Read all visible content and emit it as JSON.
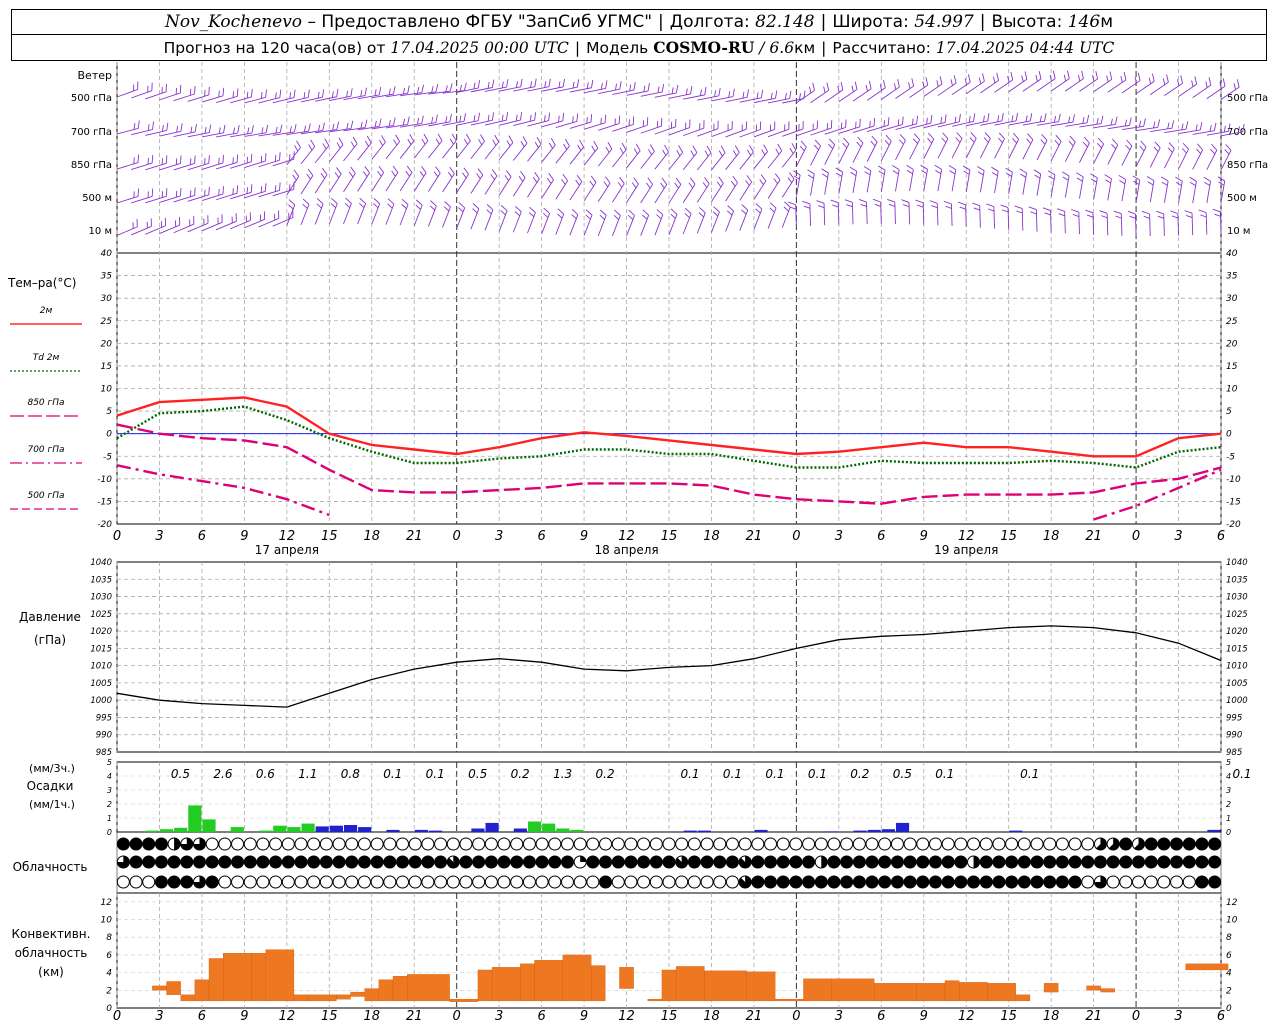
{
  "header": {
    "station": "Nov_Kochenevo",
    "provider": "– Предоставлено ФГБУ \"ЗапСиб УГМС\"",
    "lon_label": "Долгота:",
    "lon_value": "82.148",
    "lat_label": "Широта:",
    "lat_value": "54.997",
    "alt_label": "Высота:",
    "alt_value": "146",
    "alt_unit": "м",
    "forecast_prefix": "Прогноз на 120 часа(ов) от",
    "forecast_start": "17.04.2025 00:00 UTC",
    "model_label": "Модель",
    "model_name": "COSMO-RU",
    "model_res": "/ 6.6",
    "model_res_unit": "км",
    "calc_label": "Рассчитано:",
    "calc_time": "17.04.2025 04:44 UTC"
  },
  "chart_data": {
    "type": "meteogram",
    "x_hour_ticks": [
      "0",
      "3",
      "6",
      "9",
      "12",
      "15",
      "18",
      "21",
      "0",
      "3",
      "6",
      "9",
      "12",
      "15",
      "18",
      "21",
      "0",
      "3",
      "6",
      "9",
      "12",
      "15",
      "18",
      "21",
      "0",
      "3",
      "6"
    ],
    "day_labels": [
      "17 апреля",
      "18 апреля",
      "19 апреля"
    ],
    "wind": {
      "title": "Ветер",
      "levels": [
        "500 гПа",
        "700 гПа",
        "850 гПа",
        "500 м",
        "10 м"
      ]
    },
    "temperature": {
      "title": "Тем–ра(°C)",
      "ylim": [
        -20,
        40
      ],
      "ticks": [
        40,
        35,
        30,
        25,
        20,
        15,
        10,
        5,
        0,
        -5,
        -10,
        -15,
        -20
      ],
      "legend": [
        {
          "label": "2м",
          "color": "#ff0000",
          "style": "solid"
        },
        {
          "label": "Td  2м",
          "color": "#006600",
          "style": "dotted"
        },
        {
          "label": "850 гПа",
          "color": "#dd0077",
          "style": "longdash"
        },
        {
          "label": "700 гПа",
          "color": "#dd0077",
          "style": "dashdot"
        },
        {
          "label": "500 гПа",
          "color": "#dd0077",
          "style": "dashed"
        }
      ],
      "x_hours": [
        0,
        3,
        6,
        9,
        12,
        15,
        18,
        21,
        24,
        27,
        30,
        33,
        36,
        39,
        42,
        45,
        48,
        51,
        54,
        57,
        60,
        63,
        66,
        69,
        72,
        75,
        78
      ],
      "series": [
        {
          "name": "2м",
          "values": [
            4,
            7,
            7.5,
            8,
            6,
            0,
            -2.5,
            -3.5,
            -4.5,
            -3,
            -1,
            0.3,
            -0.5,
            -1.5,
            -2.5,
            -3.5,
            -4.5,
            -4,
            -3,
            -2,
            -3,
            -3,
            -4,
            -5,
            -5,
            -1,
            0
          ]
        },
        {
          "name": "Td  2м",
          "values": [
            -1,
            4.5,
            5,
            6,
            3,
            -1,
            -4,
            -6.5,
            -6.5,
            -5.5,
            -5,
            -3.5,
            -3.5,
            -4.5,
            -4.5,
            -6,
            -7.5,
            -7.5,
            -6,
            -6.5,
            -6.5,
            -6.5,
            -6,
            -6.5,
            -7.5,
            -4,
            -3
          ]
        },
        {
          "name": "850 гПа",
          "values": [
            2,
            0,
            -1,
            -1.5,
            -3,
            -8,
            -12.5,
            -13,
            -13,
            -12.5,
            -12,
            -11,
            -11,
            -11,
            -11.5,
            -13.5,
            -14.5,
            -15,
            -15.5,
            -14,
            -13.5,
            -13.5,
            -13.5,
            -13,
            -11,
            -10,
            -7.5
          ]
        },
        {
          "name": "700 гПа",
          "values": [
            -7,
            -9,
            -10.5,
            -12,
            -14.5,
            -18,
            -21,
            null,
            null,
            null,
            null,
            null,
            null,
            null,
            null,
            null,
            null,
            null,
            null,
            null,
            null,
            null,
            null,
            -19,
            -16,
            -12,
            -8
          ]
        }
      ]
    },
    "pressure": {
      "title": "Давление",
      "unit": "(гПа)",
      "ylim": [
        985,
        1040
      ],
      "ticks": [
        1040,
        1035,
        1030,
        1025,
        1020,
        1015,
        1010,
        1005,
        1000,
        995,
        990,
        985
      ],
      "x_hours": [
        0,
        3,
        6,
        9,
        12,
        15,
        18,
        21,
        24,
        27,
        30,
        33,
        36,
        39,
        42,
        45,
        48,
        51,
        54,
        57,
        60,
        63,
        66,
        69,
        72,
        75,
        78
      ],
      "values": [
        1002,
        1000,
        999,
        998.5,
        998,
        1002,
        1006,
        1009,
        1011,
        1012,
        1011,
        1009,
        1008.5,
        1009.5,
        1010,
        1012,
        1015,
        1017.5,
        1018.5,
        1019,
        1020,
        1021,
        1021.5,
        1021,
        1019.5,
        1016.5,
        1011.5
      ]
    },
    "precipitation": {
      "title": "Осадки",
      "unit_3h": "(мм/3ч.)",
      "unit_1h": "(мм/1ч.)",
      "ylim": [
        0,
        5
      ],
      "ticks": [
        5,
        4,
        3,
        2,
        1,
        0
      ],
      "totals_3h": [
        {
          "h": 3,
          "v": "0.5"
        },
        {
          "h": 6,
          "v": "2.6"
        },
        {
          "h": 9,
          "v": "0.6"
        },
        {
          "h": 12,
          "v": "1.1"
        },
        {
          "h": 15,
          "v": "0.8"
        },
        {
          "h": 18,
          "v": "0.1"
        },
        {
          "h": 21,
          "v": "0.1"
        },
        {
          "h": 24,
          "v": "0.5"
        },
        {
          "h": 27,
          "v": "0.2"
        },
        {
          "h": 30,
          "v": "1.3"
        },
        {
          "h": 33,
          "v": "0.2"
        },
        {
          "h": 39,
          "v": "0.1"
        },
        {
          "h": 42,
          "v": "0.1"
        },
        {
          "h": 45,
          "v": "0.1"
        },
        {
          "h": 48,
          "v": "0.1"
        },
        {
          "h": 51,
          "v": "0.2"
        },
        {
          "h": 54,
          "v": "0.5"
        },
        {
          "h": 57,
          "v": "0.1"
        },
        {
          "h": 63,
          "v": "0.1"
        },
        {
          "h": 78,
          "v": "0.1"
        }
      ],
      "hourly_green": [
        {
          "h": 2.5,
          "v": 0.1
        },
        {
          "h": 3.5,
          "v": 0.2
        },
        {
          "h": 4.5,
          "v": 0.3
        },
        {
          "h": 5.5,
          "v": 1.9
        },
        {
          "h": 6.5,
          "v": 0.9
        },
        {
          "h": 8.5,
          "v": 0.35
        },
        {
          "h": 10.5,
          "v": 0.1
        },
        {
          "h": 11.5,
          "v": 0.45
        },
        {
          "h": 12.5,
          "v": 0.35
        },
        {
          "h": 13.5,
          "v": 0.6
        },
        {
          "h": 15.5,
          "v": 0.1
        },
        {
          "h": 26.5,
          "v": 0.2
        },
        {
          "h": 29.5,
          "v": 0.75
        },
        {
          "h": 30.5,
          "v": 0.6
        },
        {
          "h": 31.5,
          "v": 0.25
        },
        {
          "h": 32.5,
          "v": 0.15
        }
      ],
      "hourly_blue": [
        {
          "h": 14.5,
          "v": 0.4
        },
        {
          "h": 15.5,
          "v": 0.45
        },
        {
          "h": 16.5,
          "v": 0.5
        },
        {
          "h": 17.5,
          "v": 0.35
        },
        {
          "h": 19.5,
          "v": 0.15
        },
        {
          "h": 21.5,
          "v": 0.15
        },
        {
          "h": 22.5,
          "v": 0.1
        },
        {
          "h": 25.5,
          "v": 0.25
        },
        {
          "h": 26.5,
          "v": 0.65
        },
        {
          "h": 28.5,
          "v": 0.25
        },
        {
          "h": 40.5,
          "v": 0.1
        },
        {
          "h": 41.5,
          "v": 0.1
        },
        {
          "h": 45.5,
          "v": 0.15
        },
        {
          "h": 50.5,
          "v": 0.05
        },
        {
          "h": 52.5,
          "v": 0.1
        },
        {
          "h": 53.5,
          "v": 0.15
        },
        {
          "h": 54.5,
          "v": 0.2
        },
        {
          "h": 55.5,
          "v": 0.65
        },
        {
          "h": 63.5,
          "v": 0.1
        },
        {
          "h": 77.5,
          "v": 0.15
        }
      ],
      "colors": {
        "hourly_green": "#22cc22",
        "hourly_blue": "#2222cc"
      }
    },
    "cloudiness": {
      "title": "Облачность",
      "rows": [
        "8,8,8,8,4,6,6,0,0,0,0,0,0,0,0,0,0,0,0,0,0,0,0,0,0,0,0,0,0,0,0,0,0,0,0,0,0,0,0,0,0,0,0,0,0,0,0,0,0,0,0,0,0,0,0,0,0,0,0,0,0,0,0,0,0,0,0,0,0,0,0,0,0,0,0,0,0,5,5,8,5,8,8,8,8,8,8",
        "6,8,8,8,8,8,8,8,8,8,8,8,8,8,8,8,8,8,8,8,8,8,8,8,8,8,7,8,8,8,8,8,8,8,8,8,2,8,8,8,8,8,8,8,7,8,8,8,8,7,8,8,8,8,8,4,8,8,8,8,8,8,8,8,8,8,8,4,8,8,8,8,8,8,8,8,8,8,8,8,8,8,8,8,8,8,8",
        "0,0,0,8,8,8,6,8,0,0,0,0,0,0,0,0,0,0,0,0,0,0,0,0,0,0,0,0,0,0,0,0,0,0,0,0,0,0,8,0,0,0,0,0,0,0,0,0,0,7,8,8,8,8,8,8,8,8,8,8,8,8,8,8,8,8,8,8,8,8,8,8,8,8,8,8,0,6,0,0,0,0,0,0,0,8,8"
      ]
    },
    "convective": {
      "title_lines": [
        "Конвективн.",
        "облачность",
        "(км)"
      ],
      "ylim": [
        0,
        13
      ],
      "ticks": [
        12,
        10,
        8,
        6,
        4,
        2,
        0
      ],
      "color": "#ee7722",
      "bars": [
        {
          "h0": 2.5,
          "h1": 3.5,
          "top": 2.5,
          "base": 2
        },
        {
          "h0": 3.5,
          "h1": 4.5,
          "top": 3,
          "base": 1.5
        },
        {
          "h0": 4.5,
          "h1": 5.5,
          "top": 1.5,
          "base": 0.8
        },
        {
          "h0": 5.5,
          "h1": 6.5,
          "top": 3.2,
          "base": 0.8
        },
        {
          "h0": 6.5,
          "h1": 7.5,
          "top": 5.6,
          "base": 0.8
        },
        {
          "h0": 7.5,
          "h1": 9.5,
          "top": 6.2,
          "base": 0.8
        },
        {
          "h0": 9.5,
          "h1": 10.5,
          "top": 6.2,
          "base": 0.8
        },
        {
          "h0": 10.5,
          "h1": 12.5,
          "top": 6.6,
          "base": 0.8
        },
        {
          "h0": 12.5,
          "h1": 13.5,
          "top": 1.5,
          "base": 0.8
        },
        {
          "h0": 13.5,
          "h1": 15.5,
          "top": 1.5,
          "base": 0.8
        },
        {
          "h0": 15.5,
          "h1": 16.5,
          "top": 1.5,
          "base": 1
        },
        {
          "h0": 16.5,
          "h1": 17.5,
          "top": 1.8,
          "base": 1.3
        },
        {
          "h0": 17.5,
          "h1": 18.5,
          "top": 2.2,
          "base": 0.8
        },
        {
          "h0": 18.5,
          "h1": 19.5,
          "top": 3.2,
          "base": 0.8
        },
        {
          "h0": 19.5,
          "h1": 20.5,
          "top": 3.6,
          "base": 0.8
        },
        {
          "h0": 20.5,
          "h1": 23.5,
          "top": 3.8,
          "base": 0.8
        },
        {
          "h0": 23.5,
          "h1": 25.5,
          "top": 1,
          "base": 0.7
        },
        {
          "h0": 25.5,
          "h1": 26.5,
          "top": 4.3,
          "base": 0.8
        },
        {
          "h0": 26.5,
          "h1": 28.5,
          "top": 4.6,
          "base": 0.8
        },
        {
          "h0": 28.5,
          "h1": 29.5,
          "top": 5,
          "base": 0.8
        },
        {
          "h0": 29.5,
          "h1": 31.5,
          "top": 5.4,
          "base": 0.8
        },
        {
          "h0": 31.5,
          "h1": 33.5,
          "top": 6,
          "base": 0.8
        },
        {
          "h0": 33.5,
          "h1": 34.5,
          "top": 4.8,
          "base": 0.8
        },
        {
          "h0": 35.5,
          "h1": 36.5,
          "top": 4.6,
          "base": 2.2
        },
        {
          "h0": 37.5,
          "h1": 38.5,
          "top": 1,
          "base": 0.8
        },
        {
          "h0": 38.5,
          "h1": 39.5,
          "top": 4.3,
          "base": 0.8
        },
        {
          "h0": 39.5,
          "h1": 41.5,
          "top": 4.7,
          "base": 0.8
        },
        {
          "h0": 41.5,
          "h1": 44.5,
          "top": 4.2,
          "base": 0.8
        },
        {
          "h0": 44.5,
          "h1": 46.5,
          "top": 4.1,
          "base": 0.8
        },
        {
          "h0": 46.5,
          "h1": 48.5,
          "top": 1,
          "base": 0.8
        },
        {
          "h0": 48.5,
          "h1": 50.5,
          "top": 3.3,
          "base": 0.8
        },
        {
          "h0": 50.5,
          "h1": 53.5,
          "top": 3.3,
          "base": 0.8
        },
        {
          "h0": 53.5,
          "h1": 56.5,
          "top": 2.8,
          "base": 0.8
        },
        {
          "h0": 56.5,
          "h1": 58.5,
          "top": 2.8,
          "base": 0.8
        },
        {
          "h0": 58.5,
          "h1": 59.5,
          "top": 3.1,
          "base": 0.8
        },
        {
          "h0": 59.5,
          "h1": 61.5,
          "top": 2.9,
          "base": 0.8
        },
        {
          "h0": 61.5,
          "h1": 63.5,
          "top": 2.8,
          "base": 0.8
        },
        {
          "h0": 63.5,
          "h1": 64.5,
          "top": 1.5,
          "base": 0.8
        },
        {
          "h0": 65.5,
          "h1": 66.5,
          "top": 2.8,
          "base": 1.8
        },
        {
          "h0": 68.5,
          "h1": 69.5,
          "top": 2.5,
          "base": 2
        },
        {
          "h0": 69.5,
          "h1": 70.5,
          "top": 2.2,
          "base": 1.8
        },
        {
          "h0": 75.5,
          "h1": 78.5,
          "top": 5,
          "base": 4.3
        }
      ]
    }
  }
}
